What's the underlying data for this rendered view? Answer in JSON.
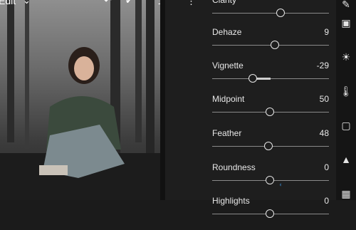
{
  "toolbar": {
    "edit_label": "Edit",
    "icons": [
      "undo-icon",
      "check-icon",
      "share-icon",
      "more-icon"
    ]
  },
  "adjustments": [
    {
      "label": "Clarity",
      "value": "",
      "level": 0.59
    },
    {
      "label": "Dehaze",
      "value": "9",
      "level": 0.545
    },
    {
      "label": "Vignette",
      "value": "-29",
      "level": 0.355,
      "fill_from": 0.5
    },
    {
      "label": "Midpoint",
      "value": "50",
      "level": 0.5
    },
    {
      "label": "Feather",
      "value": "48",
      "level": 0.49
    },
    {
      "label": "Roundness",
      "value": "0",
      "level": 0.5
    },
    {
      "label": "Highlights",
      "value": "0",
      "level": 0.5
    }
  ],
  "tools": [
    "edit-icon",
    "light-icon",
    "color-icon",
    "effects-icon",
    "detail-icon",
    "optics-icon"
  ],
  "colors": {
    "panel_bg": "#1e1e1e",
    "track": "#8a8a8a",
    "thumb": "#e6e6e6",
    "text": "#e8e8e8"
  }
}
